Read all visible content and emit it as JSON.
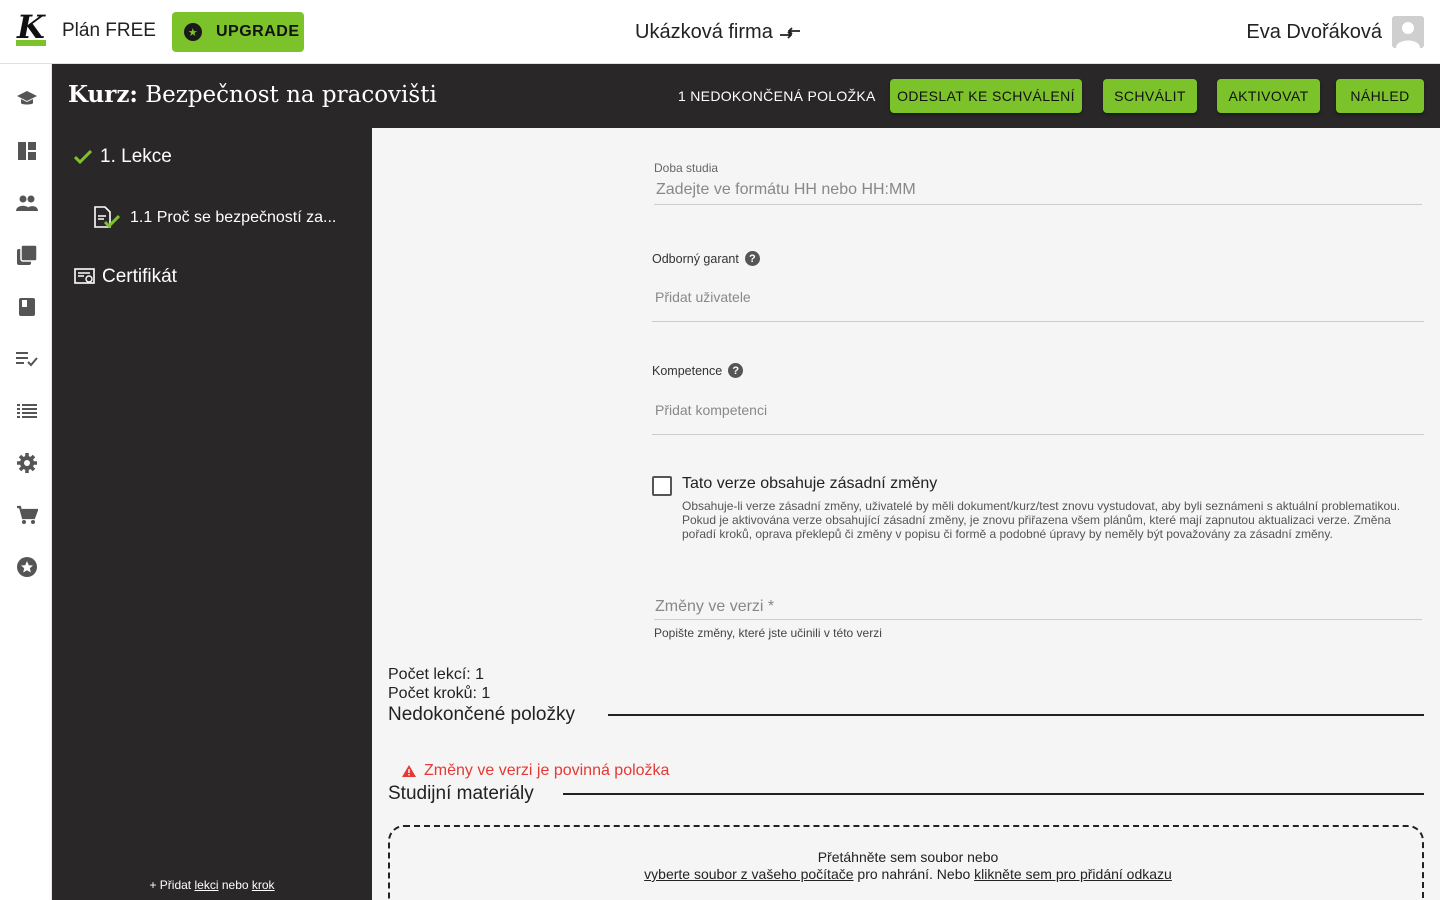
{
  "header": {
    "logo_letter": "K",
    "plan_label": "Plán FREE",
    "upgrade_label": "UPGRADE",
    "company_name": "Ukázková firma",
    "user_name": "Eva Dvořáková"
  },
  "course": {
    "title_prefix": "Kurz:",
    "title_name": "Bezpečnost na pracovišti",
    "unfinished_label": "1 NEDOKONČENÁ POLOŽKA",
    "buttons": {
      "submit": "ODESLAT KE SCHVÁLENÍ",
      "approve": "SCHVÁLIT",
      "activate": "AKTIVOVAT",
      "preview": "NÁHLED"
    }
  },
  "sidebar": {
    "lesson": "1. Lekce",
    "step": "1.1 Proč se bezpečností za...",
    "certificate": "Certifikát",
    "add_prefix": "+ Přidat",
    "add_lesson": "lekci",
    "add_or": "nebo",
    "add_step": "krok"
  },
  "form": {
    "study_time": {
      "label": "Doba studia",
      "placeholder": "Zadejte ve formátu HH nebo HH:MM"
    },
    "guarantor": {
      "label": "Odborný garant",
      "placeholder": "Přidat uživatele"
    },
    "competence": {
      "label": "Kompetence",
      "placeholder": "Přidat kompetenci"
    },
    "major_change": {
      "label": "Tato verze obsahuje zásadní změny",
      "checked": false,
      "description": "Obsahuje-li verze zásadní změny, uživatelé by měli dokument/kurz/test znovu vystudovat, aby byli seznámeni s aktuální problematikou. Pokud je aktivována verze obsahující zásadní změny, je znovu přiřazena všem plánům, které mají zapnutou aktualizaci verze. Změna pořadí kroků, oprava překlepů či změny v popisu či formě a podobné úpravy by neměly být považovány za zásadní změny."
    },
    "version_changes": {
      "placeholder": "Změny ve verzi *",
      "helper": "Popište změny, které jste učinili v této verzi"
    }
  },
  "stats": {
    "lessons": "Počet lekcí: 1",
    "steps": "Počet kroků: 1"
  },
  "unfinished_section": {
    "title": "Nedokončené položky",
    "error": "Změny ve verzi je povinná položka"
  },
  "materials": {
    "title": "Studijní materiály",
    "drop_line1": "Přetáhněte sem soubor nebo",
    "select_file": "vyberte soubor z vašeho počítače",
    "upload_text": "pro nahrání. Nebo",
    "add_link": "klikněte sem pro přidání odkazu"
  },
  "colors": {
    "accent": "#7cc22a",
    "dark": "#2a2728",
    "error": "#e53935"
  },
  "rail_icons": [
    "school-icon",
    "dashboard-icon",
    "people-icon",
    "library-icon",
    "book-icon",
    "checklist-icon",
    "list-icon",
    "settings-icon",
    "cart-icon",
    "star-badge-icon"
  ]
}
